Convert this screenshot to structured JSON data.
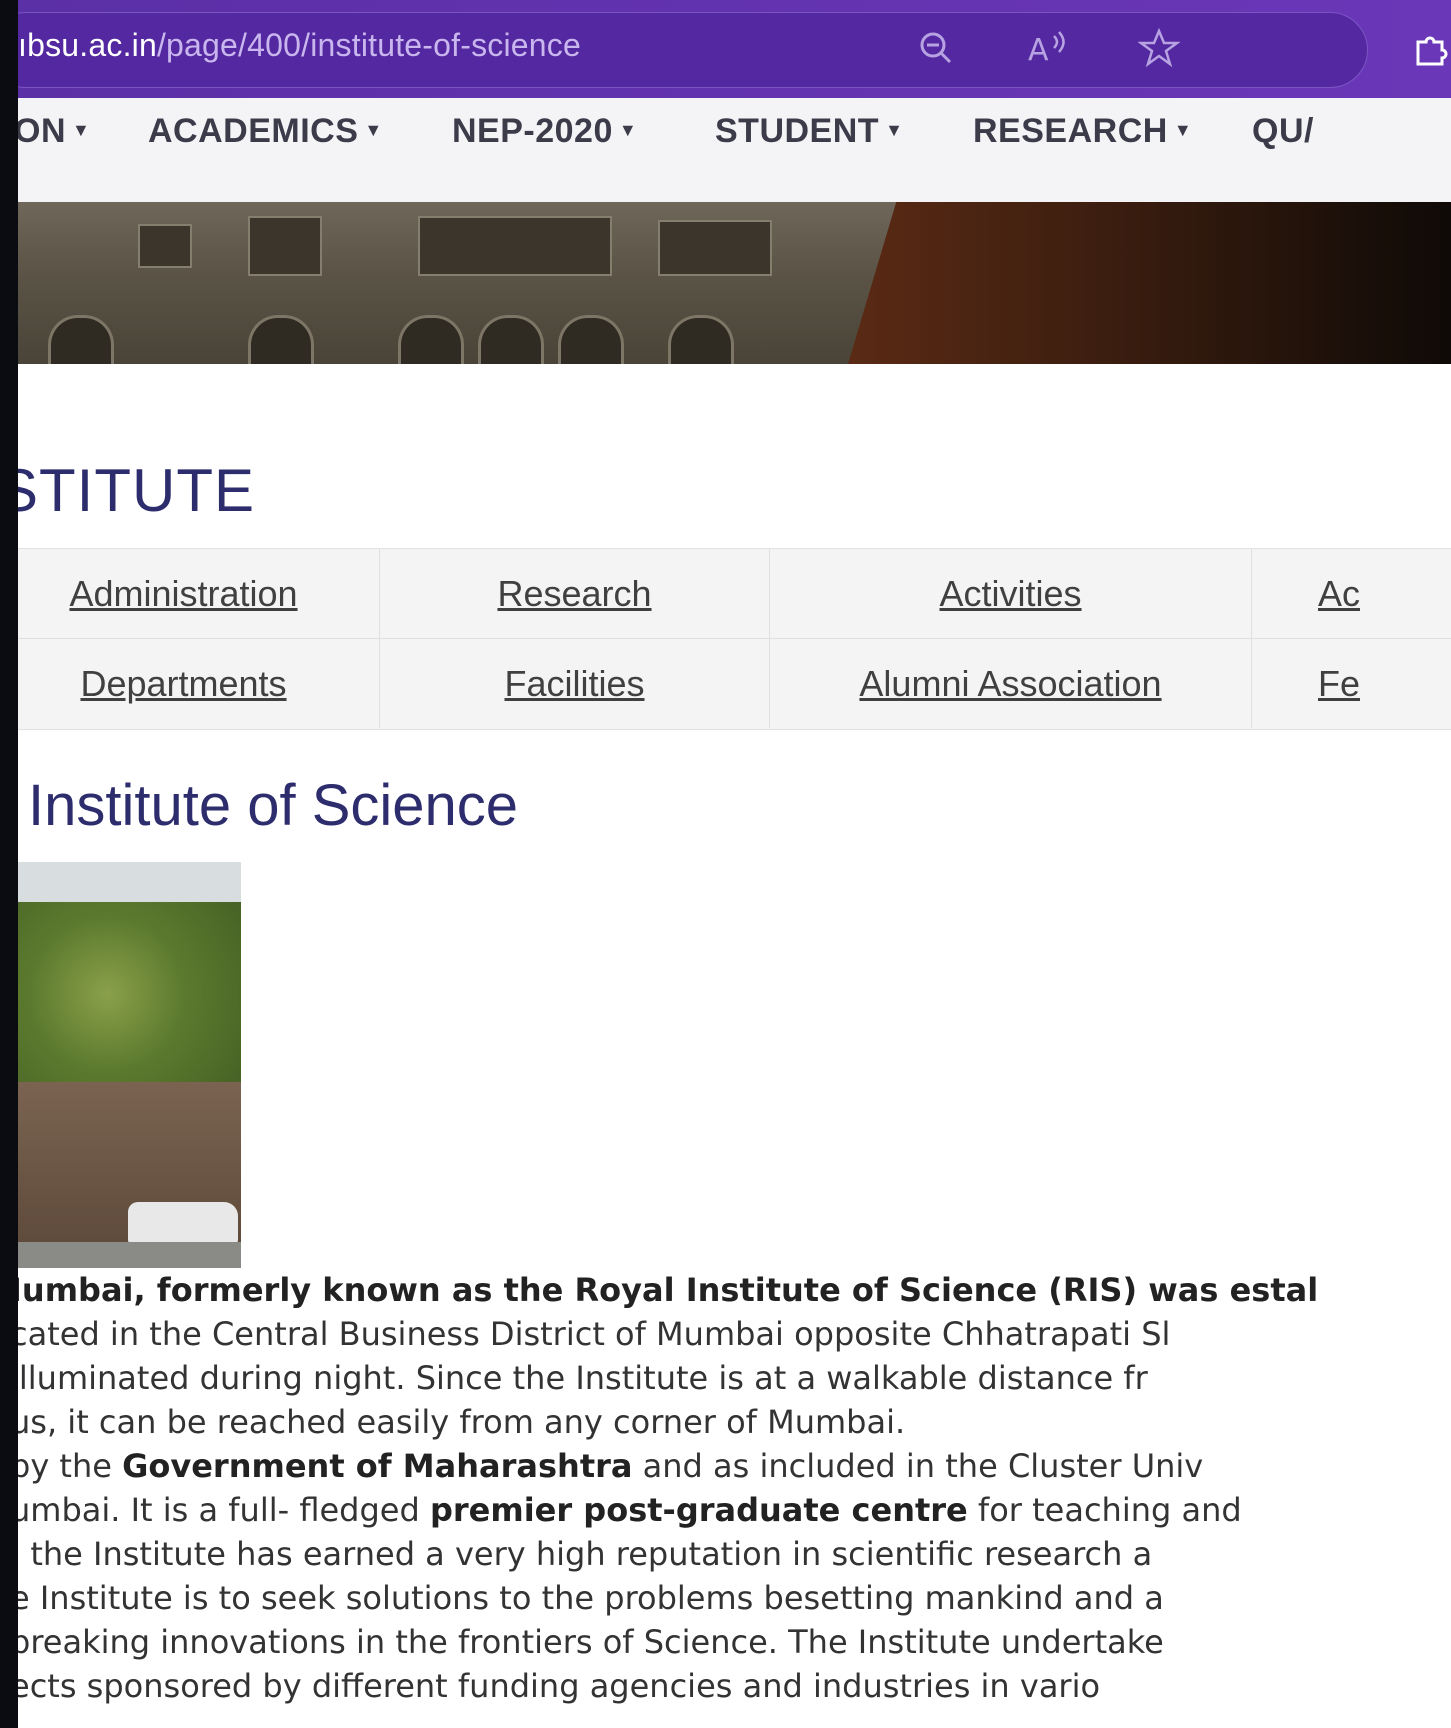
{
  "browser": {
    "url_host": "ıbsu.ac.in",
    "url_path": "/page/400/institute-of-science",
    "icons": [
      "zoom-out-icon",
      "read-aloud-icon",
      "favorite-star-icon",
      "extensions-icon"
    ]
  },
  "nav": {
    "items": [
      {
        "label": "ON"
      },
      {
        "label": "ACADEMICS"
      },
      {
        "label": "NEP-2020"
      },
      {
        "label": "STUDENT"
      },
      {
        "label": "RESEARCH"
      },
      {
        "label": "QU/"
      }
    ]
  },
  "section_heading": "STITUTE",
  "links": {
    "row1": [
      "Administration",
      "Research",
      "Activities",
      "Ac"
    ],
    "row2": [
      "Departments",
      "Facilities",
      "Alumni Association",
      "Fe"
    ]
  },
  "page_title": "Institute of Science",
  "paragraph": {
    "l1_bold": "Iumbai, formerly known as the Royal Institute of Science (RIS) was estal",
    "l2": "cated in the Central Business District of Mumbai opposite Chhatrapati Sl",
    "l3": " illuminated during night. Since the Institute is at a walkable distance fr",
    "l4": "us, it can be reached easily from any corner of Mumbai.",
    "l5_a": "by the ",
    "l5_b": "Government of Maharashtra",
    "l5_c": " and as included in the Cluster Univ",
    "l6_a": "umbai. It is a full- fledged ",
    "l6_b": "premier post-graduate centre",
    "l6_c": " for teaching and",
    "l7": ", the Institute has earned a very high reputation in scientific research a",
    "l8": "e Institute is to seek solutions to the problems besetting mankind and a",
    "l9": " breaking innovations in the frontiers of Science. The Institute undertake",
    "l10": "ects sponsored by different funding agencies and industries in vario"
  }
}
